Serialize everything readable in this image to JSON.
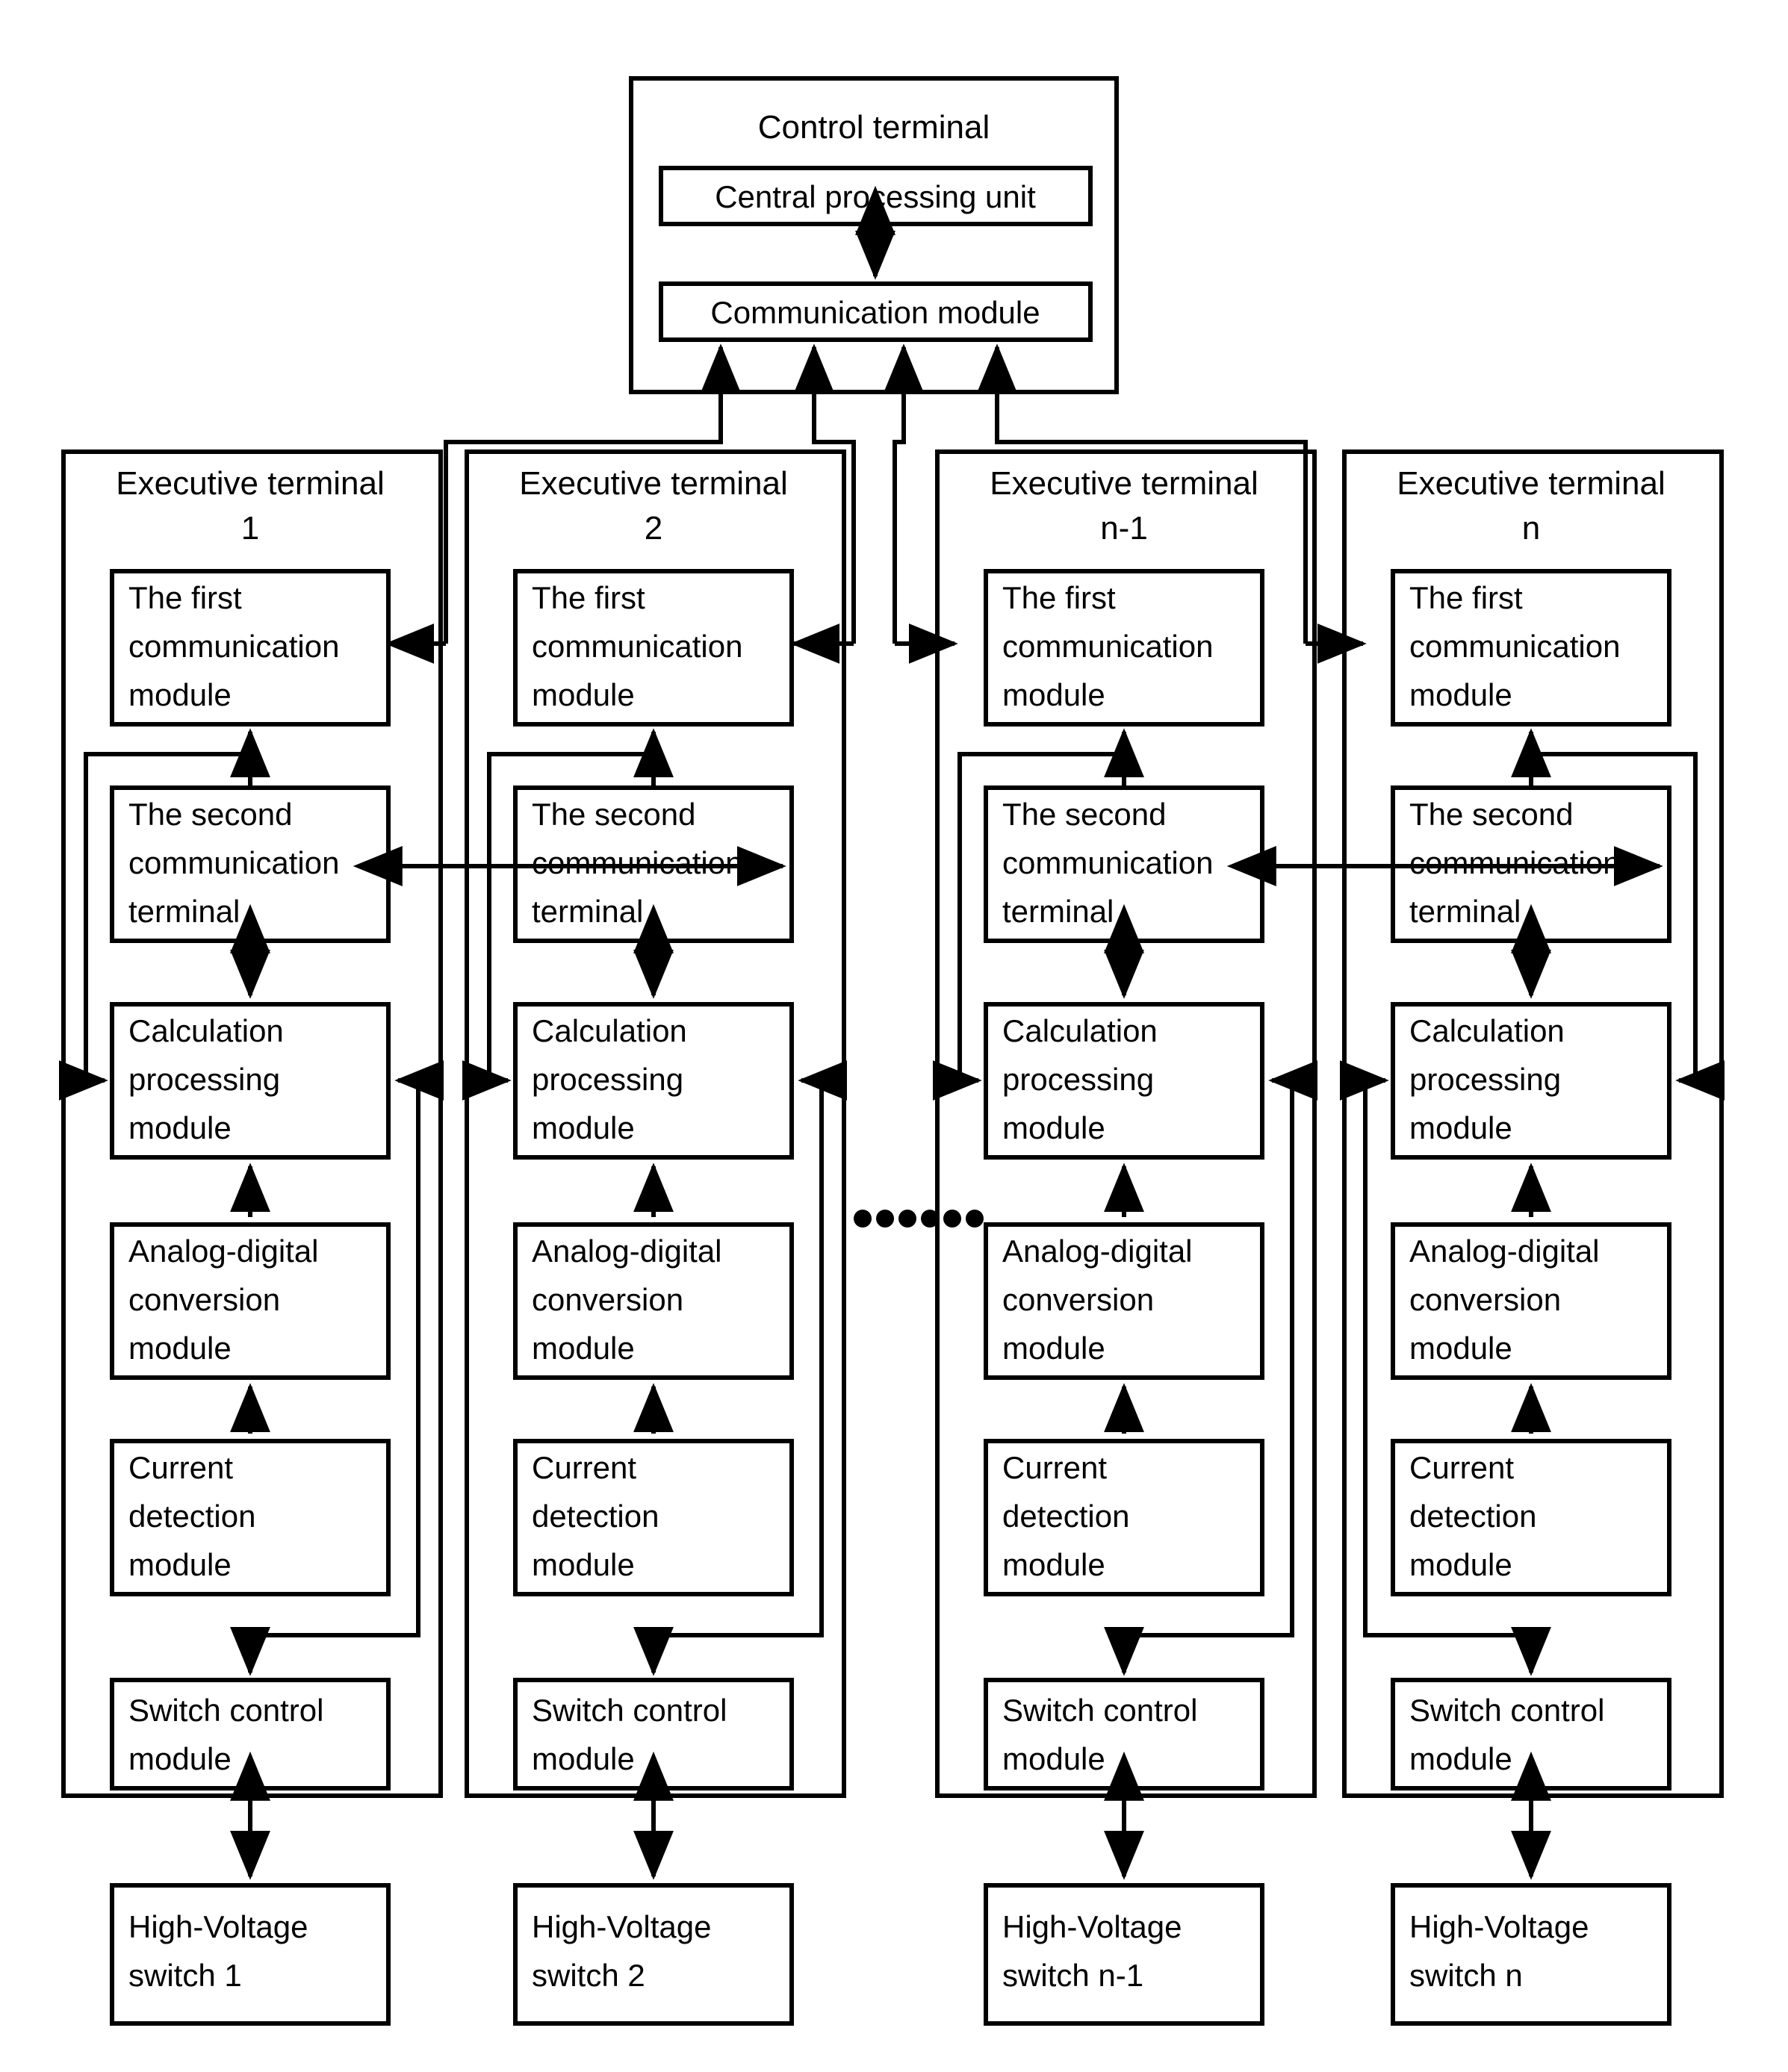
{
  "diagram": {
    "title_semantic": "distributed-high-voltage-switch-control-system-block-diagram",
    "control_terminal": {
      "label": "Control terminal",
      "blocks": [
        {
          "id": "cpu",
          "label": "Central processing unit"
        },
        {
          "id": "comm",
          "label": "Communication module"
        }
      ]
    },
    "ellipsis": "......",
    "executive_terminals": [
      {
        "id": "t1",
        "title_line1": "Executive terminal",
        "title_line2": "1",
        "blocks": [
          {
            "id": "first-comm",
            "lines": [
              "The first",
              "communication",
              "module"
            ]
          },
          {
            "id": "second-comm",
            "lines": [
              "The second",
              "communication",
              "terminal"
            ]
          },
          {
            "id": "calc",
            "lines": [
              "Calculation",
              "processing",
              "module"
            ]
          },
          {
            "id": "adc",
            "lines": [
              "Analog-digital",
              "conversion",
              "module"
            ]
          },
          {
            "id": "current",
            "lines": [
              "Current",
              "detection",
              "module"
            ]
          },
          {
            "id": "switch-ctrl",
            "lines": [
              "Switch control",
              "module"
            ]
          }
        ],
        "high_voltage_switch": {
          "lines": [
            "High-Voltage",
            "switch 1"
          ]
        }
      },
      {
        "id": "t2",
        "title_line1": "Executive terminal",
        "title_line2": "2",
        "blocks": [
          {
            "id": "first-comm",
            "lines": [
              "The first",
              "communication",
              "module"
            ]
          },
          {
            "id": "second-comm",
            "lines": [
              "The second",
              "communication",
              "terminal"
            ]
          },
          {
            "id": "calc",
            "lines": [
              "Calculation",
              "processing",
              "module"
            ]
          },
          {
            "id": "adc",
            "lines": [
              "Analog-digital",
              "conversion",
              "module"
            ]
          },
          {
            "id": "current",
            "lines": [
              "Current",
              "detection",
              "module"
            ]
          },
          {
            "id": "switch-ctrl",
            "lines": [
              "Switch control",
              "module"
            ]
          }
        ],
        "high_voltage_switch": {
          "lines": [
            "High-Voltage",
            "switch 2"
          ]
        }
      },
      {
        "id": "tn1",
        "title_line1": "Executive terminal",
        "title_line2": "n-1",
        "blocks": [
          {
            "id": "first-comm",
            "lines": [
              "The first",
              "communication",
              "module"
            ]
          },
          {
            "id": "second-comm",
            "lines": [
              "The second",
              "communication",
              "terminal"
            ]
          },
          {
            "id": "calc",
            "lines": [
              "Calculation",
              "processing",
              "module"
            ]
          },
          {
            "id": "adc",
            "lines": [
              "Analog-digital",
              "conversion",
              "module"
            ]
          },
          {
            "id": "current",
            "lines": [
              "Current",
              "detection",
              "module"
            ]
          },
          {
            "id": "switch-ctrl",
            "lines": [
              "Switch control",
              "module"
            ]
          }
        ],
        "high_voltage_switch": {
          "lines": [
            "High-Voltage",
            "switch n-1"
          ]
        }
      },
      {
        "id": "tn",
        "title_line1": "Executive terminal",
        "title_line2": "n",
        "blocks": [
          {
            "id": "first-comm",
            "lines": [
              "The first",
              "communication",
              "module"
            ]
          },
          {
            "id": "second-comm",
            "lines": [
              "The second",
              "communication",
              "terminal"
            ]
          },
          {
            "id": "calc",
            "lines": [
              "Calculation",
              "processing",
              "module"
            ]
          },
          {
            "id": "adc",
            "lines": [
              "Analog-digital",
              "conversion",
              "module"
            ]
          },
          {
            "id": "current",
            "lines": [
              "Current",
              "detection",
              "module"
            ]
          },
          {
            "id": "switch-ctrl",
            "lines": [
              "Switch control",
              "module"
            ]
          }
        ],
        "high_voltage_switch": {
          "lines": [
            "High-Voltage",
            "switch n"
          ]
        }
      }
    ],
    "colors": {
      "stroke": "#000000",
      "fill": "#ffffff"
    }
  }
}
